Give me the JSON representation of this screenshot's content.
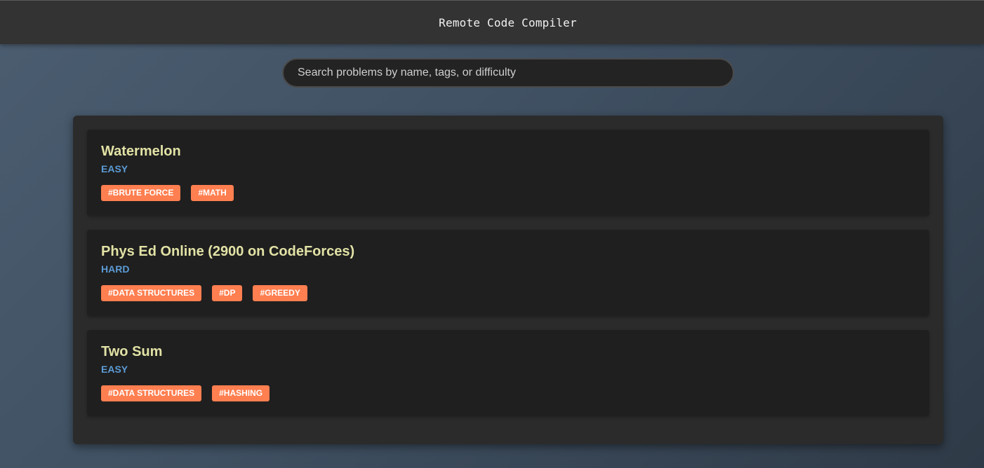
{
  "header": {
    "title": "Remote Code Compiler"
  },
  "search": {
    "placeholder": "Search problems by name, tags, or difficulty",
    "value": ""
  },
  "problems": [
    {
      "title": "Watermelon",
      "difficulty": "EASY",
      "tags": [
        "#BRUTE FORCE",
        "#MATH"
      ]
    },
    {
      "title": "Phys Ed Online (2900 on CodeForces)",
      "difficulty": "HARD",
      "tags": [
        "#DATA STRUCTURES",
        "#DP",
        "#GREEDY"
      ]
    },
    {
      "title": "Two Sum",
      "difficulty": "EASY",
      "tags": [
        "#DATA STRUCTURES",
        "#HASHING"
      ]
    }
  ],
  "colors": {
    "title": "#e2e2a6",
    "difficulty": "#5b9bd5",
    "tag_background": "#ff7f50",
    "header_background": "#333333",
    "panel_background": "#2b2b2b",
    "card_background": "#1f1f1f"
  }
}
